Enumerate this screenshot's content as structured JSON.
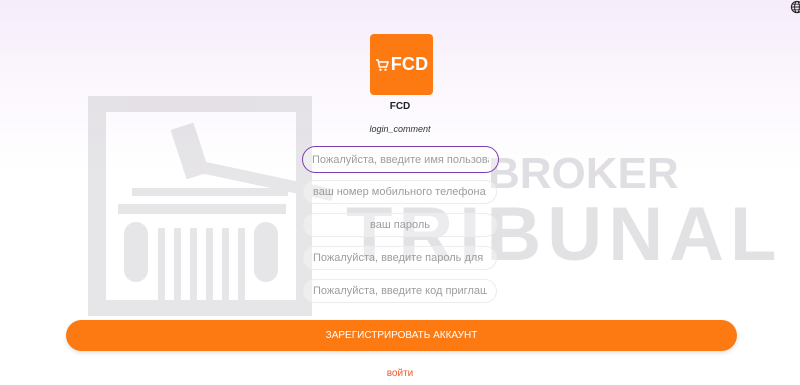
{
  "app": {
    "logo_text": "FCD",
    "name": "FCD",
    "comment": "login_comment"
  },
  "form": {
    "username_placeholder": "Пожалуйста, введите имя пользователя",
    "phone_placeholder": "ваш номер мобильного телефона",
    "password_placeholder": "ваш пароль",
    "confirm_password_placeholder": "Пожалуйста, введите пароль для подтверждения",
    "invite_code_placeholder": "Пожалуйста, введите код приглашения"
  },
  "actions": {
    "register_label": "ЗАРЕГИСТРИРОВАТЬ АККАУНТ",
    "login_label": "войти"
  },
  "watermark": {
    "line1": "BROKER",
    "line2": "TRIBUNAL"
  },
  "icons": {
    "language": "globe-icon",
    "logo": "cart-icon"
  },
  "colors": {
    "accent": "#fd7a12",
    "focus_border": "#7c3fb0",
    "login_link": "#f25a2a"
  }
}
